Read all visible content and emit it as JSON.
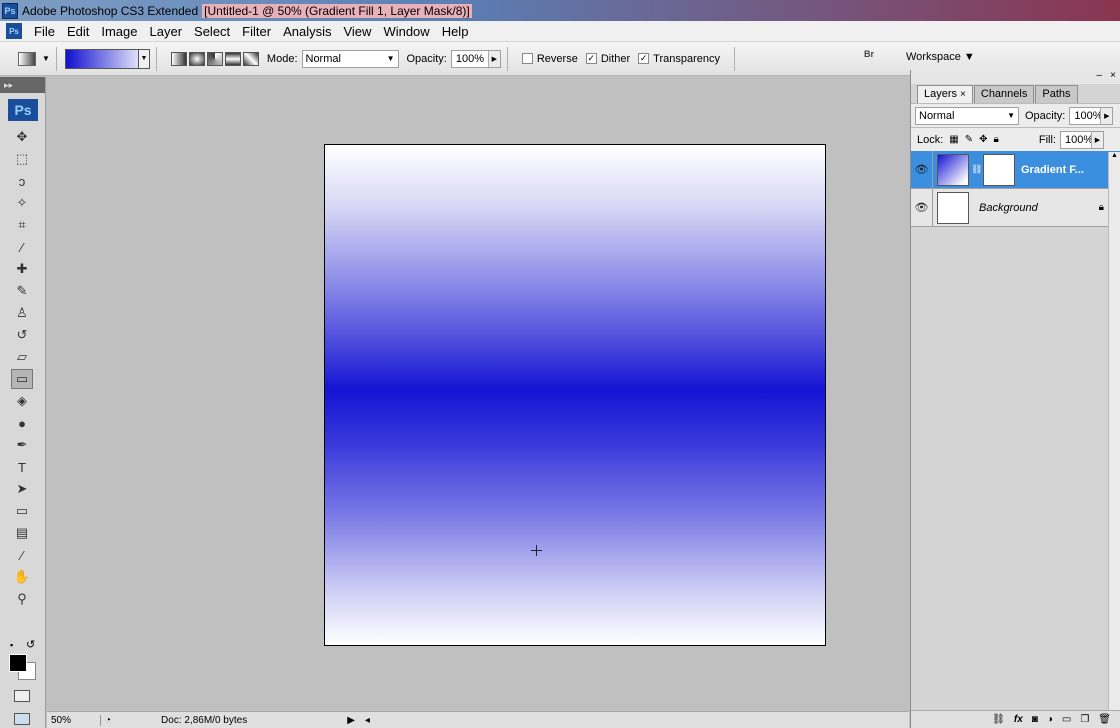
{
  "window": {
    "app_icon": "Ps",
    "title": "Adobe Photoshop CS3 Extended",
    "doc_title": "[Untitled-1 @ 50% (Gradient Fill 1, Layer Mask/8)]"
  },
  "menu": {
    "icon": "Ps",
    "items": [
      "File",
      "Edit",
      "Image",
      "Layer",
      "Select",
      "Filter",
      "Analysis",
      "View",
      "Window",
      "Help"
    ]
  },
  "options": {
    "mode_label": "Mode:",
    "mode_value": "Normal",
    "opacity_label": "Opacity:",
    "opacity_value": "100%",
    "reverse_label": "Reverse",
    "reverse_checked": false,
    "dither_label": "Dither",
    "dither_checked": true,
    "transparency_label": "Transparency",
    "transparency_checked": true,
    "bridge_label": "Br",
    "workspace_label": "Workspace",
    "gradient_colors": [
      "#1010d0",
      "#ffffff"
    ]
  },
  "toolbar": {
    "grip_label": "▸▸",
    "logo": "Ps",
    "tools": [
      {
        "name": "move-tool-icon",
        "glyph": "✥"
      },
      {
        "name": "marquee-tool-icon",
        "glyph": "⬚"
      },
      {
        "name": "lasso-tool-icon",
        "glyph": "ↄ"
      },
      {
        "name": "magic-wand-tool-icon",
        "glyph": "✧"
      },
      {
        "name": "crop-tool-icon",
        "glyph": "⌗"
      },
      {
        "name": "slice-tool-icon",
        "glyph": "⁄"
      },
      {
        "name": "healing-brush-tool-icon",
        "glyph": "✚"
      },
      {
        "name": "brush-tool-icon",
        "glyph": "✎"
      },
      {
        "name": "clone-stamp-tool-icon",
        "glyph": "♙"
      },
      {
        "name": "history-brush-tool-icon",
        "glyph": "↺"
      },
      {
        "name": "eraser-tool-icon",
        "glyph": "▱"
      },
      {
        "name": "gradient-tool-icon",
        "glyph": "▭"
      },
      {
        "name": "blur-tool-icon",
        "glyph": "◈"
      },
      {
        "name": "dodge-tool-icon",
        "glyph": "●"
      },
      {
        "name": "pen-tool-icon",
        "glyph": "✒"
      },
      {
        "name": "type-tool-icon",
        "glyph": "T"
      },
      {
        "name": "path-selection-tool-icon",
        "glyph": "➤"
      },
      {
        "name": "shape-tool-icon",
        "glyph": "▭"
      },
      {
        "name": "notes-tool-icon",
        "glyph": "▤"
      },
      {
        "name": "eyedropper-tool-icon",
        "glyph": "⁄"
      },
      {
        "name": "hand-tool-icon",
        "glyph": "✋"
      },
      {
        "name": "zoom-tool-icon",
        "glyph": "⚲"
      }
    ],
    "active_tool": "gradient-tool-icon",
    "foreground_color": "#000000",
    "background_color": "#ffffff"
  },
  "status": {
    "zoom": "50%",
    "doc_info": "Doc: 2,86M/0 bytes"
  },
  "layers_panel": {
    "tabs": [
      "Layers",
      "Channels",
      "Paths"
    ],
    "blend_mode": "Normal",
    "opacity_label": "Opacity:",
    "opacity_value": "100%",
    "lock_label": "Lock:",
    "fill_label": "Fill:",
    "fill_value": "100%",
    "layers": [
      {
        "name": "Gradient F...",
        "selected": true
      },
      {
        "name": "Background",
        "selected": false
      }
    ],
    "bottom_icons": [
      "link-icon",
      "fx-icon",
      "mask-icon",
      "adjustment-icon",
      "folder-icon",
      "new-layer-icon",
      "trash-icon"
    ]
  }
}
